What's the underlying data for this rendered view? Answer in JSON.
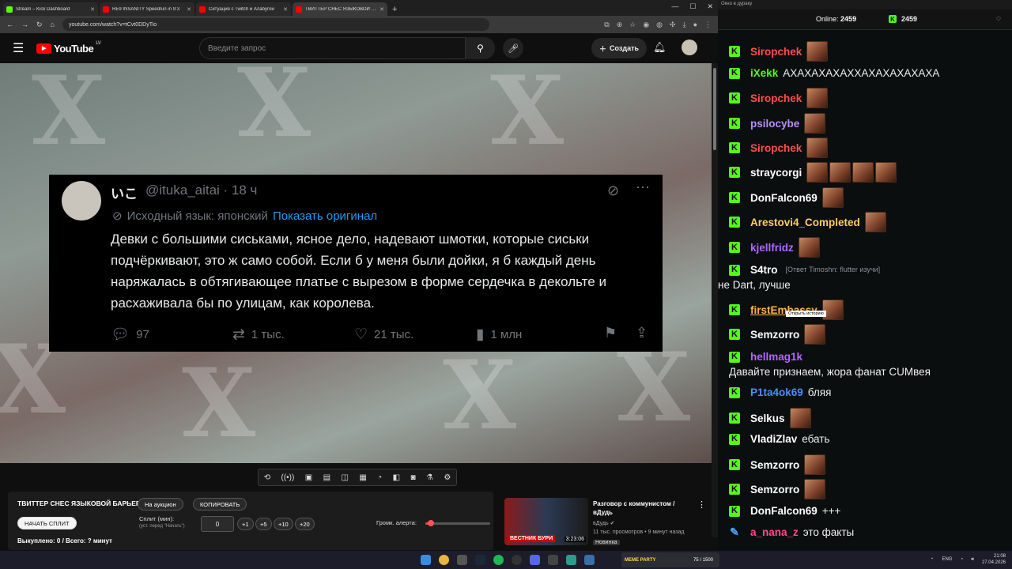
{
  "browser": {
    "tabs": [
      {
        "label": "Stream – Kick Dashboard",
        "color": "#53fc18"
      },
      {
        "label": "RE9 INSANITY Speedrun in 9:3",
        "color": "#ff0000"
      },
      {
        "label": "Ситуация с Twitch и Алабугой",
        "color": "#ff0000"
      },
      {
        "label": "ТВИТТЕР СНЕС ЯЗЫКОВОЙ БА",
        "color": "#ff0000"
      }
    ],
    "url": "youtube.com/watch?v=tCvt0DDyTio"
  },
  "youtube": {
    "logo_text": "YouTube",
    "region": "LV",
    "search_placeholder": "Введите запрос",
    "create_label": "Создать"
  },
  "tweet": {
    "name": "いこ",
    "handle": "@ituka_aitai · 18 ч",
    "translated_label": "Исходный язык: японский",
    "show_original": "Показать оригинал",
    "text": "Девки с большими сиськами, ясное дело, надевают шмотки, которые сиськи подчёркивают, это ж само собой. Если б у меня были дойки, я б каждый день наряжалась в обтягивающее платье с вырезом в форме сердечка в декольте и расхаживала бы по улицам, как королева.",
    "replies": "97",
    "reposts": "1 тыс.",
    "likes": "21 тыс.",
    "views": "1 млн"
  },
  "panel": {
    "title": "ТВИТТЕР СНЕС ЯЗЫКОВОЙ БАРЬЕР",
    "auction_button": "На аукцион",
    "copy_button": "КОПИРОВАТЬ",
    "start_split_button": "НАЧАТЬ СПЛИТ",
    "split_label": "Сплит (мин):",
    "split_hint": "(уст. перед \"Начать\")",
    "split_value": "0",
    "increments": [
      "+1",
      "+5",
      "+10",
      "+20"
    ],
    "alert_volume_label": "Громк. алерта:",
    "alert_volume_level": 0.08,
    "bought": "Выкуплено: 0 / Всего: ? минут"
  },
  "recommended": {
    "title": "Разговор с коммунистом / вДудь",
    "channel": "вДудь",
    "meta": "11 тыс. просмотров • 9 минут назад",
    "badge": "Новинка",
    "duration": "3:23:06",
    "thumb_label": "ВЕСТНИК БУРИ"
  },
  "chat": {
    "window_title": "Окно в дураку",
    "online_label": "Online:",
    "online_count": "2459",
    "kick_count": "2459",
    "tooltip": "Открыть историю",
    "messages": [
      {
        "user": "Siropchek",
        "color": "#ff4d4d",
        "text": "",
        "emotes": 1
      },
      {
        "user": "iXekk",
        "color": "#53fc18",
        "text": "АХАХАХАХАХХАХАХАХАХАХА",
        "emotes": 0
      },
      {
        "user": "Siropchek",
        "color": "#ff4d4d",
        "text": "",
        "emotes": 1
      },
      {
        "user": "psilocybe",
        "color": "#b98cff",
        "text": "",
        "emotes": 1
      },
      {
        "user": "Siropchek",
        "color": "#ff4d4d",
        "text": "",
        "emotes": 1
      },
      {
        "user": "straycorgi",
        "color": "#ffffff",
        "text": "",
        "emotes": 4
      },
      {
        "user": "DonFalcon69",
        "color": "#ffffff",
        "text": "",
        "emotes": 1
      },
      {
        "user": "Arestovi4_Completed",
        "color": "#ffcc66",
        "text": "",
        "emotes": 1
      },
      {
        "user": "kjellfridz",
        "color": "#b366ff",
        "text": "",
        "emotes": 1
      },
      {
        "user": "S4tro",
        "color": "#ffffff",
        "reply": "[Ответ Timoshn: flutter изучи]",
        "text": "не Dart, лучше",
        "emotes": 0
      },
      {
        "user": "firstEmbassy",
        "color": "#ffb347",
        "text": "",
        "emotes": 1
      },
      {
        "user": "Semzorro",
        "color": "#ffffff",
        "text": "",
        "emotes": 1
      },
      {
        "user": "hellmag1k",
        "color": "#b366ff",
        "text": "Давайте признаем, жора фанат CUMвея",
        "emotes": 0
      },
      {
        "user": "P1ta4ok69",
        "color": "#4d8cff",
        "text": "бляя",
        "emotes": 0
      },
      {
        "user": "Selkus",
        "color": "#ffffff",
        "text": "",
        "emotes": 1
      },
      {
        "user": "VladiZlav",
        "color": "#ffffff",
        "text": "ебать",
        "emotes": 0
      },
      {
        "user": "Semzorro",
        "color": "#ffffff",
        "text": "",
        "emotes": 1
      },
      {
        "user": "Semzorro",
        "color": "#ffffff",
        "text": "",
        "emotes": 1
      },
      {
        "user": "DonFalcon69",
        "color": "#ffffff",
        "text": "+++",
        "emotes": 0
      },
      {
        "user": "a_nana_z",
        "color": "#ff4d8c",
        "text": "это факты",
        "emotes": 0
      }
    ]
  },
  "taskbar": {
    "meme_party": "MEME PARTY",
    "meme_count": "75 / 1500",
    "lang": "ENG",
    "time": "21:08",
    "date": "27.04.2026"
  }
}
